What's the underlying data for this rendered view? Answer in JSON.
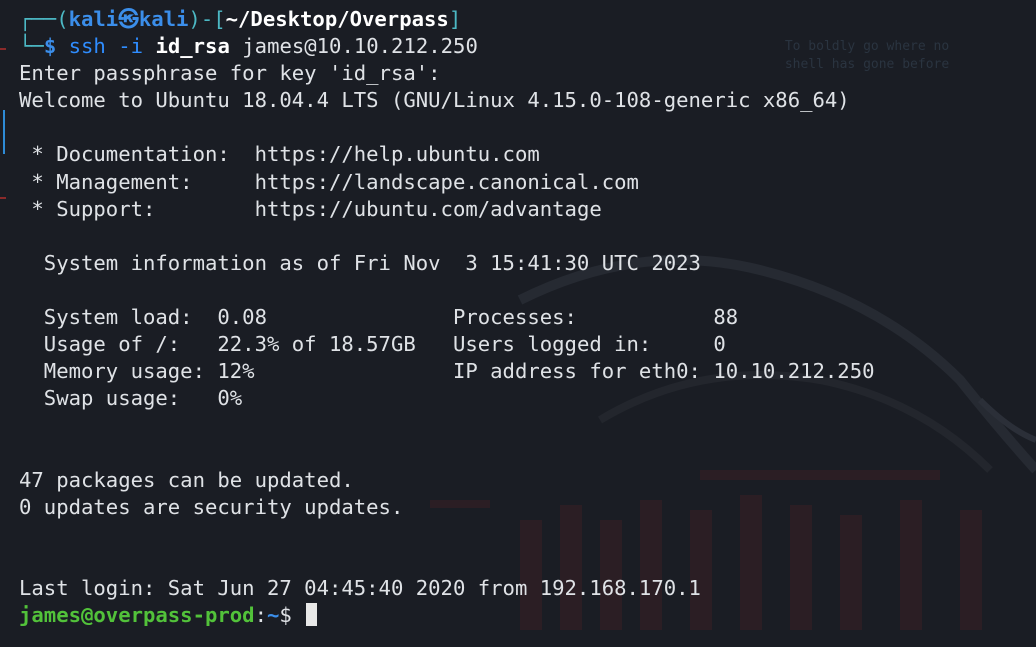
{
  "prompt": {
    "box_top": "┌──(",
    "user": "kali",
    "at_icon": "㉿",
    "host": "kali",
    "mid": ")-[",
    "path": "~/Desktop/Overpass",
    "close": "]",
    "box_bottom": "└─",
    "dollar": "$",
    "cmd": "ssh",
    "flag": "-i",
    "keyfile": "id_rsa",
    "target": "james@10.10.212.250"
  },
  "output": {
    "passphrase": "Enter passphrase for key 'id_rsa':",
    "welcome": "Welcome to Ubuntu 18.04.4 LTS (GNU/Linux 4.15.0-108-generic x86_64)",
    "links": [
      {
        "label": " * Documentation:  ",
        "url": "https://help.ubuntu.com"
      },
      {
        "label": " * Management:     ",
        "url": "https://landscape.canonical.com"
      },
      {
        "label": " * Support:        ",
        "url": "https://ubuntu.com/advantage"
      }
    ],
    "sysinfo_header": "  System information as of Fri Nov  3 15:41:30 UTC 2023",
    "stats": [
      {
        "left": "  System load:  0.08               ",
        "right": "Processes:           88"
      },
      {
        "left": "  Usage of /:   22.3% of 18.57GB   ",
        "right": "Users logged in:     0"
      },
      {
        "left": "  Memory usage: 12%                ",
        "right": "IP address for eth0: 10.10.212.250"
      },
      {
        "left": "  Swap usage:   0%",
        "right": ""
      }
    ],
    "updates": "47 packages can be updated.",
    "security": "0 updates are security updates.",
    "last_login": "Last login: Sat Jun 27 04:45:40 2020 from 192.168.170.1"
  },
  "remote_prompt": {
    "userhost": "james@overpass-prod",
    "sep": ":",
    "path": "~",
    "dollar": "$ "
  },
  "watermark": {
    "line1": "To boldly go where no",
    "line2": "shell has gone before"
  },
  "colors": {
    "background": "#1a1d24",
    "prompt_blue": "#3b8eea",
    "remote_green": "#52c23a",
    "text": "#dfe2e6"
  }
}
